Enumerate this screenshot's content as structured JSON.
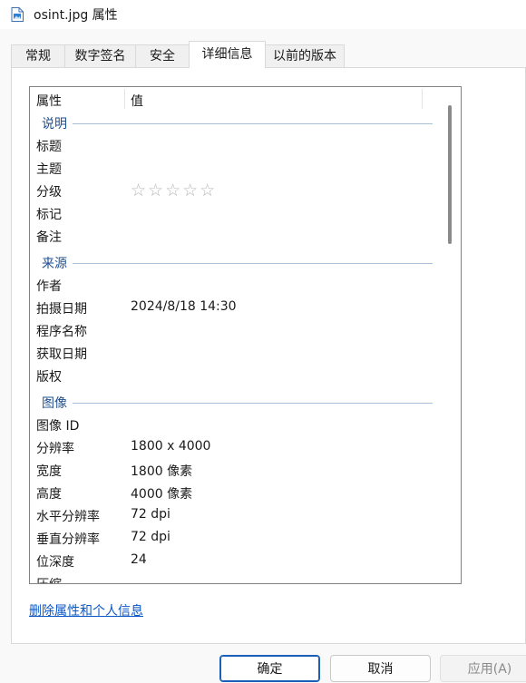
{
  "window": {
    "title": "osint.jpg 属性"
  },
  "tabs": [
    {
      "label": "常规"
    },
    {
      "label": "数字签名"
    },
    {
      "label": "安全"
    },
    {
      "label": "详细信息"
    },
    {
      "label": "以前的版本"
    }
  ],
  "columns": {
    "property": "属性",
    "value": "值"
  },
  "groups": {
    "description": "说明",
    "origin": "来源",
    "image": "图像"
  },
  "description_rows": [
    {
      "k": "标题",
      "v": ""
    },
    {
      "k": "主题",
      "v": ""
    },
    {
      "k": "分级",
      "v": ""
    },
    {
      "k": "标记",
      "v": ""
    },
    {
      "k": "备注",
      "v": ""
    }
  ],
  "rating": {
    "stars": "☆☆☆☆☆",
    "value": 0
  },
  "origin_rows": [
    {
      "k": "作者",
      "v": ""
    },
    {
      "k": "拍摄日期",
      "v": "2024/8/18 14:30"
    },
    {
      "k": "程序名称",
      "v": ""
    },
    {
      "k": "获取日期",
      "v": ""
    },
    {
      "k": "版权",
      "v": ""
    }
  ],
  "image_rows": [
    {
      "k": "图像 ID",
      "v": ""
    },
    {
      "k": "分辨率",
      "v": "1800 x 4000"
    },
    {
      "k": "宽度",
      "v": "1800 像素"
    },
    {
      "k": "高度",
      "v": "4000 像素"
    },
    {
      "k": "水平分辨率",
      "v": "72 dpi"
    },
    {
      "k": "垂直分辨率",
      "v": "72 dpi"
    },
    {
      "k": "位深度",
      "v": "24"
    },
    {
      "k": "压缩",
      "v": ""
    }
  ],
  "link": "删除属性和个人信息",
  "buttons": {
    "ok": "确定",
    "cancel": "取消",
    "apply": "应用(A)"
  },
  "colors": {
    "link": "#0b57c5",
    "group": "#1f4f8f",
    "accent": "#1c5fb8"
  }
}
